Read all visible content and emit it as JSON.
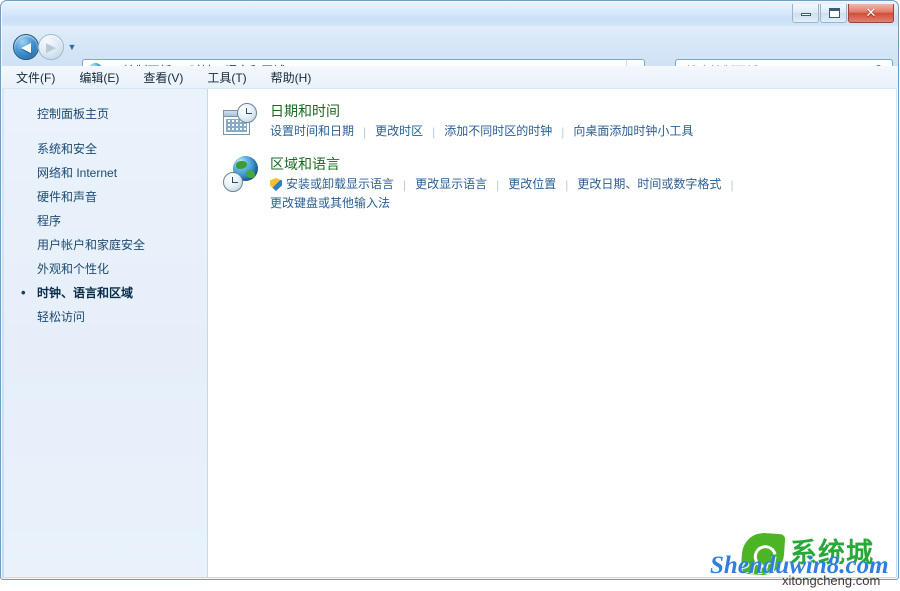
{
  "window": {
    "title": "",
    "buttons": {
      "minimize": "minimize",
      "maximize": "maximize",
      "close": "✕"
    }
  },
  "nav": {
    "back_glyph": "◀",
    "forward_glyph": "▶",
    "history_glyph": "▼",
    "refresh_glyph": "↻",
    "breadcrumb": {
      "separator": "▸",
      "items": [
        "控制面板",
        "时钟、语言和区域"
      ],
      "dropdown_glyph": "▾"
    }
  },
  "search": {
    "placeholder": "搜索控制面板",
    "icon_glyph": "⚲"
  },
  "menubar": {
    "items": [
      "文件(F)",
      "编辑(E)",
      "查看(V)",
      "工具(T)",
      "帮助(H)"
    ]
  },
  "sidebar": {
    "home": "控制面板主页",
    "items": [
      {
        "label": "系统和安全",
        "active": false
      },
      {
        "label": "网络和 Internet",
        "active": false
      },
      {
        "label": "硬件和声音",
        "active": false
      },
      {
        "label": "程序",
        "active": false
      },
      {
        "label": "用户帐户和家庭安全",
        "active": false
      },
      {
        "label": "外观和个性化",
        "active": false
      },
      {
        "label": "时钟、语言和区域",
        "active": true
      },
      {
        "label": "轻松访问",
        "active": false
      }
    ]
  },
  "main": {
    "categories": [
      {
        "icon": "date-time-icon",
        "title": "日期和时间",
        "links_row1": [
          {
            "label": "设置时间和日期",
            "shield": false
          },
          {
            "label": "更改时区",
            "shield": false
          },
          {
            "label": "添加不同时区的时钟",
            "shield": false
          },
          {
            "label": "向桌面添加时钟小工具",
            "shield": false
          }
        ],
        "links_row2": []
      },
      {
        "icon": "region-language-icon",
        "title": "区域和语言",
        "links_row1": [
          {
            "label": "安装或卸载显示语言",
            "shield": true
          },
          {
            "label": "更改显示语言",
            "shield": false
          },
          {
            "label": "更改位置",
            "shield": false
          },
          {
            "label": "更改日期、时间或数字格式",
            "shield": false
          }
        ],
        "links_row2": [
          {
            "label": "更改键盘或其他输入法",
            "shield": false
          }
        ]
      }
    ],
    "link_separator": "|"
  },
  "watermark": {
    "brand": "Shenduwin8.com",
    "chinese": "系统城",
    "sub": "xitongcheng.com"
  },
  "colors": {
    "category_title": "#1b6b1f",
    "link": "#2a5f93",
    "sidebar_link": "#1c4a72",
    "frame": "#6f9ec4",
    "close_button": "#cf4f39",
    "watermark_brand": "#2f7fe0",
    "watermark_chinese": "#29a83a"
  }
}
